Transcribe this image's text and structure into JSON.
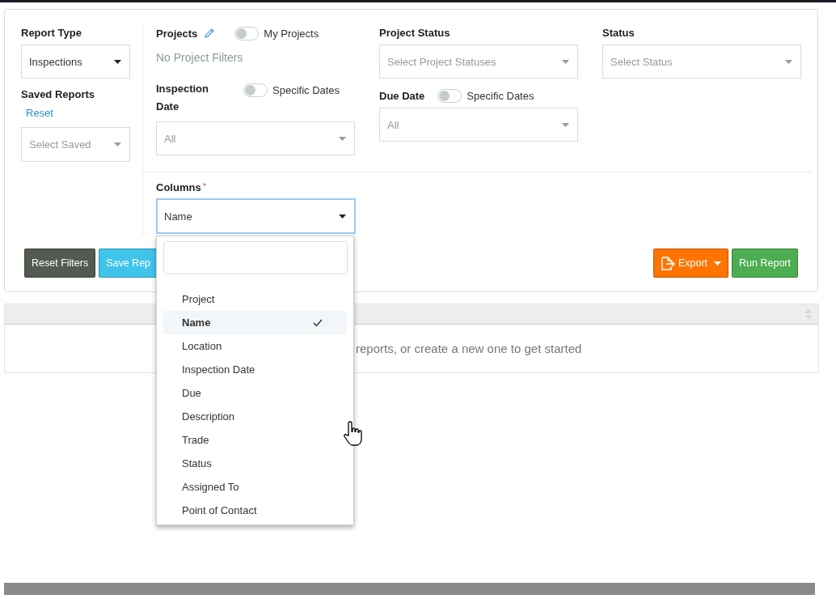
{
  "report_type": {
    "label": "Report Type",
    "value": "Inspections"
  },
  "saved_reports": {
    "label": "Saved Reports",
    "reset_link": "Reset",
    "placeholder": "Select Saved"
  },
  "projects": {
    "label": "Projects",
    "toggle": {
      "label": "My Projects",
      "on": false
    },
    "note": "No Project Filters"
  },
  "project_status": {
    "label": "Project Status",
    "placeholder": "Select Project Statuses"
  },
  "status": {
    "label": "Status",
    "placeholder": "Select Status"
  },
  "inspection_date": {
    "label": "Inspection Date",
    "toggle": {
      "label": "Specific Dates",
      "on": false
    },
    "placeholder": "All"
  },
  "due_date": {
    "label": "Due Date",
    "toggle": {
      "label": "Specific Dates",
      "on": false
    },
    "placeholder": "All"
  },
  "columns": {
    "label": "Columns",
    "required_mark": "*",
    "value": "Name",
    "options": [
      {
        "label": "Project",
        "selected": false
      },
      {
        "label": "Name",
        "selected": true
      },
      {
        "label": "Location",
        "selected": false
      },
      {
        "label": "Inspection Date",
        "selected": false
      },
      {
        "label": "Due",
        "selected": false
      },
      {
        "label": "Description",
        "selected": false
      },
      {
        "label": "Trade",
        "selected": false
      },
      {
        "label": "Status",
        "selected": false
      },
      {
        "label": "Assigned To",
        "selected": false
      },
      {
        "label": "Point of Contact",
        "selected": false
      }
    ]
  },
  "buttons": [
    {
      "kind": "reset",
      "label": "Reset Filters"
    },
    {
      "kind": "save",
      "label": "Save Rep"
    },
    {
      "kind": "export",
      "label": "Export"
    },
    {
      "kind": "run",
      "label": "Run Report"
    }
  ],
  "table": {
    "empty_message": "reports, or create a new one to get started"
  }
}
